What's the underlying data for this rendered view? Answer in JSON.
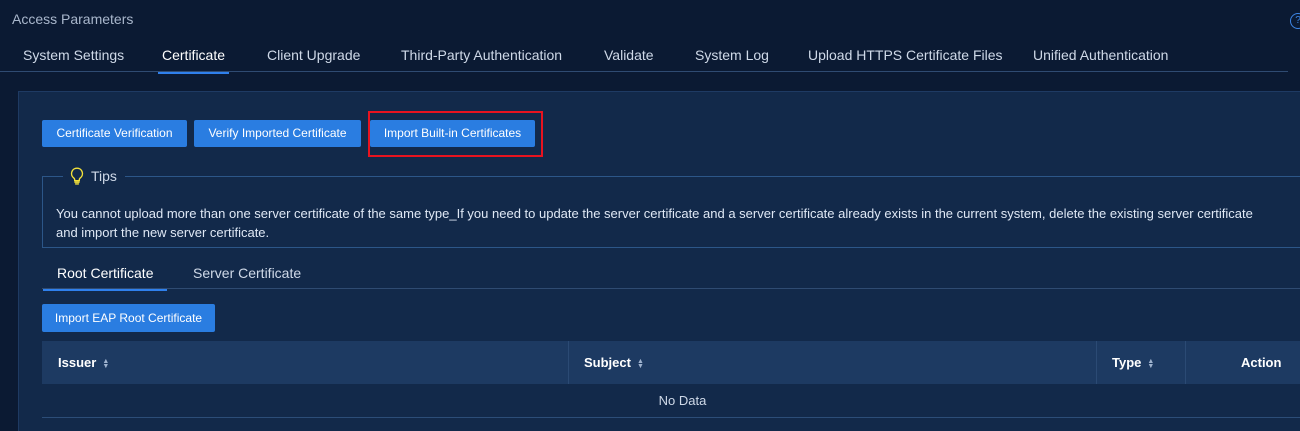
{
  "page": {
    "title": "Access Parameters",
    "help_icon": "?"
  },
  "main_tabs": [
    {
      "label": "System Settings"
    },
    {
      "label": "Certificate",
      "active": true
    },
    {
      "label": "Client Upgrade"
    },
    {
      "label": "Third-Party Authentication"
    },
    {
      "label": "Validate"
    },
    {
      "label": "System Log"
    },
    {
      "label": "Upload HTTPS Certificate Files"
    },
    {
      "label": "Unified Authentication"
    }
  ],
  "actions": {
    "certificate_verification": "Certificate Verification",
    "verify_imported": "Verify Imported Certificate",
    "import_builtin": "Import Built-in Certificates"
  },
  "tips": {
    "title": "Tips",
    "icon": "lightbulb-icon",
    "text": "You cannot upload more than one server certificate of the same type_If you need to update the server certificate and a server certificate already exists in the current system, delete the existing server certificate and import the new server certificate."
  },
  "sub_tabs": [
    {
      "label": "Root Certificate",
      "active": true
    },
    {
      "label": "Server Certificate"
    }
  ],
  "import_eap_button": "Import EAP Root Certificate",
  "table": {
    "columns": [
      {
        "label": "Issuer",
        "sortable": true
      },
      {
        "label": "Subject",
        "sortable": true
      },
      {
        "label": "Type",
        "sortable": true
      },
      {
        "label": "Action",
        "sortable": false
      }
    ],
    "empty_text": "No Data"
  },
  "colors": {
    "accent": "#2a7de1",
    "background": "#0b1a33",
    "panel": "#12294a",
    "highlight": "#e8131f",
    "bulb": "#f4e23a"
  }
}
